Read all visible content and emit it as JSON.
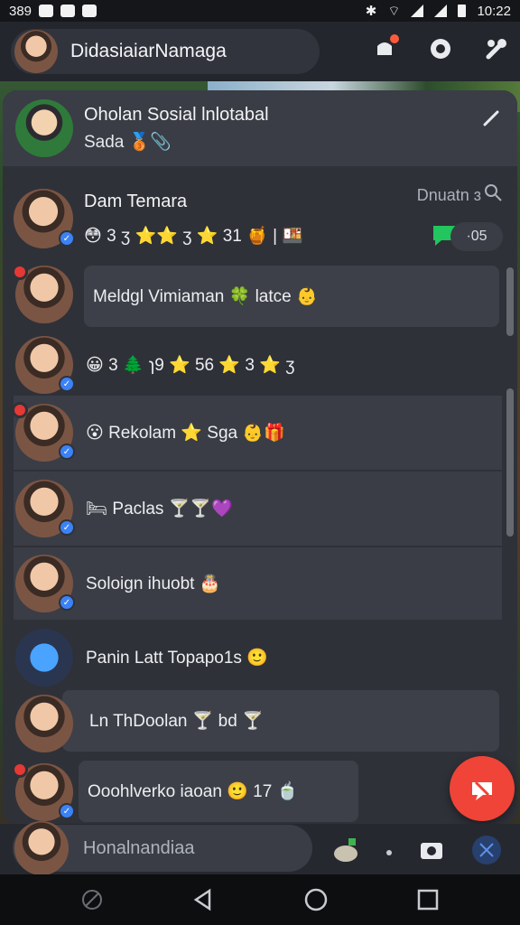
{
  "status_bar": {
    "left_text": "389",
    "time": "10:22"
  },
  "account": {
    "name": "DidasiaiarNamaga"
  },
  "pinned": {
    "title": "Oholan Sosial lnlotabal",
    "subtitle": "Sada 🥉📎"
  },
  "first_contact": {
    "name": "Dam Temara",
    "meta": "Dnuatn ɜ",
    "message": "😳 3 ʒ ⭐⭐ ʒ ⭐ 31 🍯 | 🍱",
    "count": "·05"
  },
  "conversations": [
    {
      "message": "Meldgl Vimiaman 🍀 latce 👶"
    },
    {
      "message": "😀 3 🌲 ɿ9 ⭐ 56 ⭐ 3 ⭐ ʒ"
    },
    {
      "message": "😮 Rekolam ⭐ Sga 👶🎁"
    },
    {
      "message": "🛏 Paclas 🍸🍸💜"
    },
    {
      "message": "Soloign ihuobt 🎂"
    },
    {
      "message": "Panin Latt Topapo1s 🙂"
    },
    {
      "message": "Ln ThDoolan 🍸 bd 🍸"
    },
    {
      "message": "Ooohlverko iaoan 🙂 17 🍵"
    }
  ],
  "compose": {
    "placeholder": "Honalnandiaa"
  },
  "colors": {
    "fab": "#ef4437",
    "accent_blue": "#3b82f6",
    "badge_red": "#e53935"
  }
}
